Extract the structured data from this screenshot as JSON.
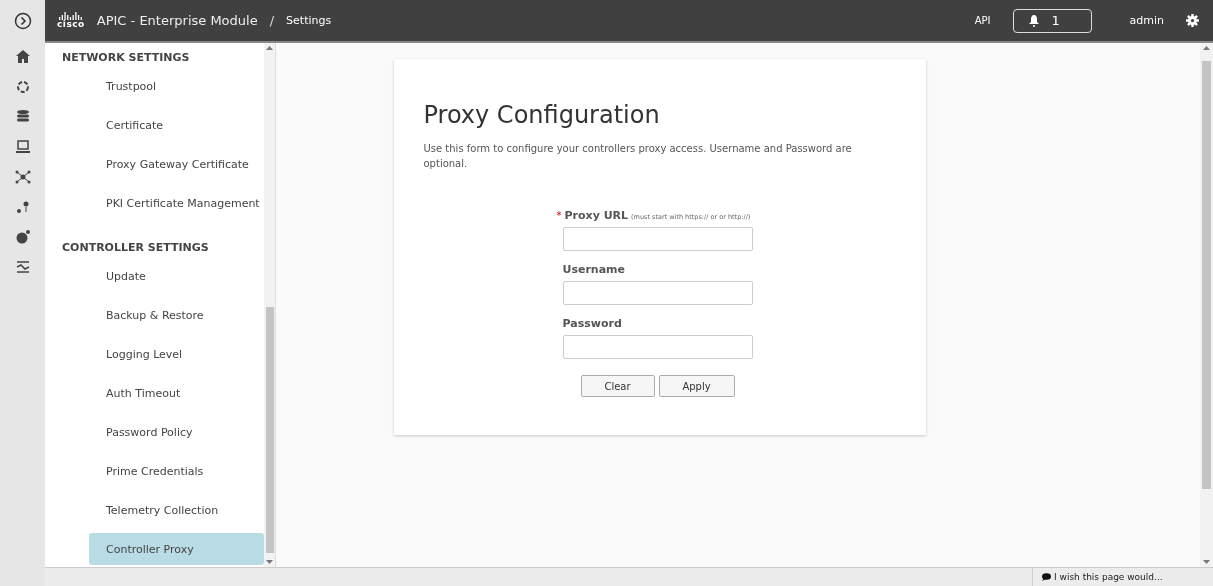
{
  "top_bar": {
    "logo_text": "cisco",
    "app_title": "APIC - Enterprise Module",
    "separator": "/",
    "page": "Settings",
    "api_link": "API",
    "notifications": "1",
    "user": "admin"
  },
  "rail": {
    "items": [
      {
        "kind": "home"
      },
      {
        "kind": "ring"
      },
      {
        "kind": "database"
      },
      {
        "kind": "laptop"
      },
      {
        "kind": "network"
      },
      {
        "kind": "pins"
      },
      {
        "kind": "globe"
      },
      {
        "kind": "lines"
      }
    ]
  },
  "sidebar": {
    "sections": [
      {
        "title": "NETWORK SETTINGS",
        "items": [
          {
            "label": "Trustpool",
            "selected": false
          },
          {
            "label": "Certificate",
            "selected": false
          },
          {
            "label": "Proxy Gateway Certificate",
            "selected": false
          },
          {
            "label": "PKI Certificate Management",
            "selected": false
          }
        ]
      },
      {
        "title": "CONTROLLER SETTINGS",
        "items": [
          {
            "label": "Update",
            "selected": false
          },
          {
            "label": "Backup & Restore",
            "selected": false
          },
          {
            "label": "Logging Level",
            "selected": false
          },
          {
            "label": "Auth Timeout",
            "selected": false
          },
          {
            "label": "Password Policy",
            "selected": false
          },
          {
            "label": "Prime Credentials",
            "selected": false
          },
          {
            "label": "Telemetry Collection",
            "selected": false
          },
          {
            "label": "Controller Proxy",
            "selected": true
          }
        ]
      }
    ]
  },
  "form": {
    "title": "Proxy Configuration",
    "description": "Use this form to configure your controllers proxy access. Username and Password are optional.",
    "fields": [
      {
        "label": "Proxy URL",
        "required": true,
        "required_mark": "*",
        "hint": "(must start with https:// or or http://)"
      },
      {
        "label": "Username",
        "required": false
      },
      {
        "label": "Password",
        "required": false
      }
    ],
    "buttons": [
      "Clear",
      "Apply"
    ]
  },
  "footer": {
    "feedback": "I wish this page would..."
  }
}
